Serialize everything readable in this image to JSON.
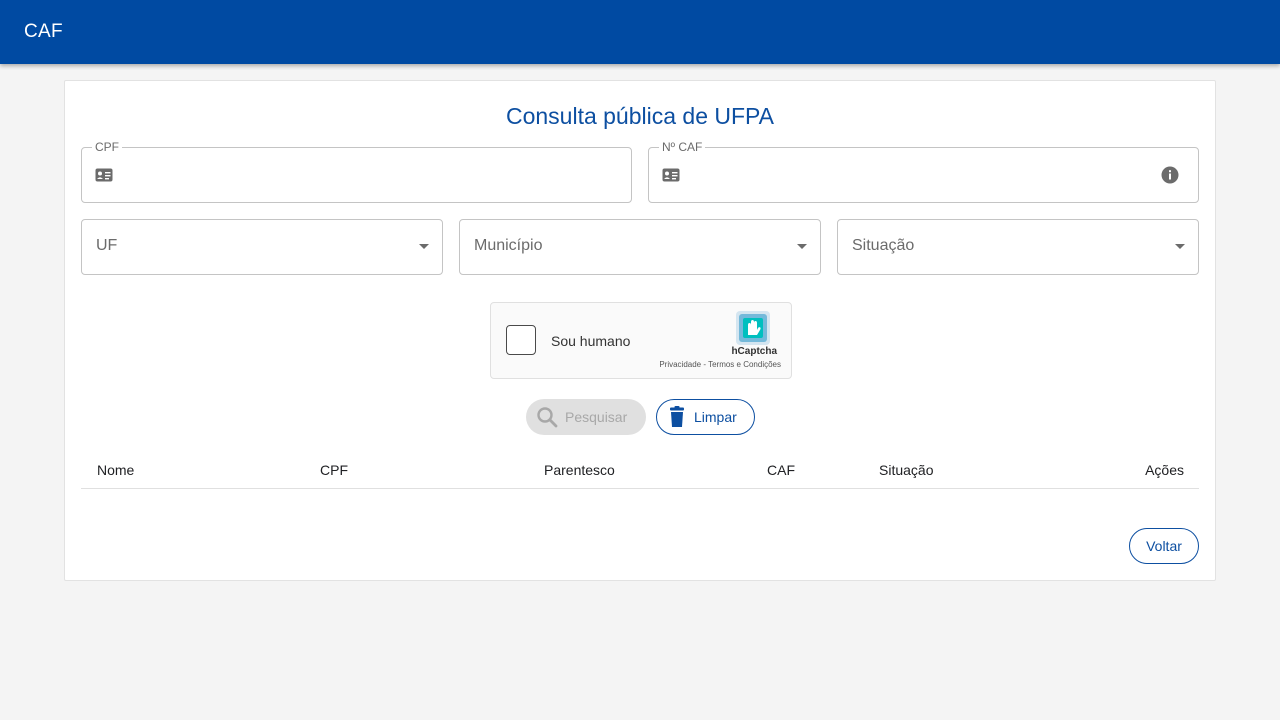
{
  "app": {
    "title": "CAF"
  },
  "page": {
    "title": "Consulta pública de UFPA"
  },
  "form": {
    "cpf": {
      "label": "CPF",
      "value": ""
    },
    "caf": {
      "label": "Nº CAF",
      "value": ""
    },
    "uf": {
      "label": "UF"
    },
    "municipio": {
      "label": "Município"
    },
    "situacao": {
      "label": "Situação"
    }
  },
  "captcha": {
    "label": "Sou humano",
    "brand": "hCaptcha",
    "links": "Privacidade - Termos e Condições"
  },
  "buttons": {
    "search": "Pesquisar",
    "clear": "Limpar",
    "back": "Voltar"
  },
  "table": {
    "columns": [
      "Nome",
      "CPF",
      "Parentesco",
      "CAF",
      "Situação",
      "Ações"
    ],
    "rows": []
  },
  "colors": {
    "primary": "#004aa2",
    "accent": "#0d4fa1",
    "disabled": "#e0e0e0"
  }
}
